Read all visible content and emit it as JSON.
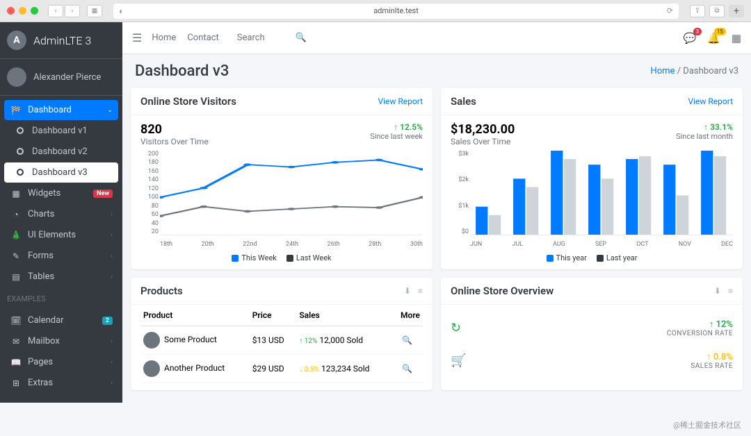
{
  "browser": {
    "url": "adminIte.test"
  },
  "brand": {
    "name": "AdminLTE 3",
    "logo_letter": "A"
  },
  "user": {
    "name": "Alexander Pierce"
  },
  "sidebar": {
    "dashboard": "Dashboard",
    "dash_children": [
      "Dashboard v1",
      "Dashboard v2",
      "Dashboard v3"
    ],
    "items": [
      {
        "icon": "th",
        "label": "Widgets",
        "badge": "New",
        "badge_type": "danger"
      },
      {
        "icon": "pie",
        "label": "Charts"
      },
      {
        "icon": "tree",
        "label": "UI Elements"
      },
      {
        "icon": "edit",
        "label": "Forms"
      },
      {
        "icon": "table",
        "label": "Tables"
      }
    ],
    "header_examples": "EXAMPLES",
    "examples": [
      {
        "icon": "calendar",
        "label": "Calendar",
        "badge": "2",
        "badge_type": "info"
      },
      {
        "icon": "mail",
        "label": "Mailbox"
      },
      {
        "icon": "book",
        "label": "Pages"
      },
      {
        "icon": "plus",
        "label": "Extras"
      }
    ]
  },
  "topbar": {
    "links": [
      "Home",
      "Contact"
    ],
    "search_placeholder": "Search",
    "badge_comments": "3",
    "badge_bell": "15"
  },
  "header": {
    "title": "Dashboard v3",
    "breadcrumb_home": "Home",
    "breadcrumb_current": "Dashboard v3"
  },
  "visitors_card": {
    "title": "Online Store Visitors",
    "link": "View Report",
    "value": "820",
    "subtitle": "Visitors Over Time",
    "change": "12.5%",
    "since": "Since last week",
    "legend": [
      "This Week",
      "Last Week"
    ]
  },
  "sales_card": {
    "title": "Sales",
    "link": "View Report",
    "value": "$18,230.00",
    "subtitle": "Sales Over Time",
    "change": "33.1%",
    "since": "Since last month",
    "legend": [
      "This year",
      "Last year"
    ]
  },
  "chart_data": [
    {
      "type": "line",
      "title": "Visitors Over Time",
      "categories": [
        "18th",
        "20th",
        "22nd",
        "24th",
        "26th",
        "28th",
        "30th"
      ],
      "series": [
        {
          "name": "This Week",
          "values": [
            100,
            120,
            170,
            165,
            175,
            180,
            160
          ],
          "color": "#007bff"
        },
        {
          "name": "Last Week",
          "values": [
            60,
            80,
            70,
            75,
            80,
            78,
            100
          ],
          "color": "#6c757d"
        }
      ],
      "ylim": [
        20,
        200
      ],
      "yticks": [
        200,
        180,
        160,
        140,
        120,
        100,
        80,
        60,
        40,
        20
      ]
    },
    {
      "type": "bar",
      "title": "Sales Over Time",
      "categories": [
        "JUN",
        "JUL",
        "AUG",
        "SEP",
        "OCT",
        "NOV",
        "DEC"
      ],
      "series": [
        {
          "name": "This year",
          "values": [
            1000,
            2000,
            3000,
            2500,
            2700,
            2500,
            3000
          ],
          "color": "#007bff"
        },
        {
          "name": "Last year",
          "values": [
            700,
            1700,
            2700,
            2000,
            2800,
            1400,
            2800
          ],
          "color": "#ced4da"
        }
      ],
      "ylim": [
        0,
        3000
      ],
      "yticks": [
        "$3k",
        "$2k",
        "$1k",
        "$0"
      ]
    }
  ],
  "products_card": {
    "title": "Products",
    "columns": [
      "Product",
      "Price",
      "Sales",
      "More"
    ],
    "rows": [
      {
        "name": "Some Product",
        "price": "$13 USD",
        "pct": "12%",
        "dir": "up",
        "sold": "12,000 Sold"
      },
      {
        "name": "Another Product",
        "price": "$29 USD",
        "pct": "0.5%",
        "dir": "down",
        "sold": "123,234 Sold"
      }
    ]
  },
  "overview_card": {
    "title": "Online Store Overview",
    "rows": [
      {
        "icon": "refresh",
        "pct": "12%",
        "dir": "up",
        "label": "CONVERSION RATE",
        "color": "#28a745"
      },
      {
        "icon": "cart",
        "pct": "0.8%",
        "dir": "up",
        "label": "SALES RATE",
        "color": "#ffc107"
      }
    ]
  },
  "watermark": "@稀土掘金技术社区"
}
